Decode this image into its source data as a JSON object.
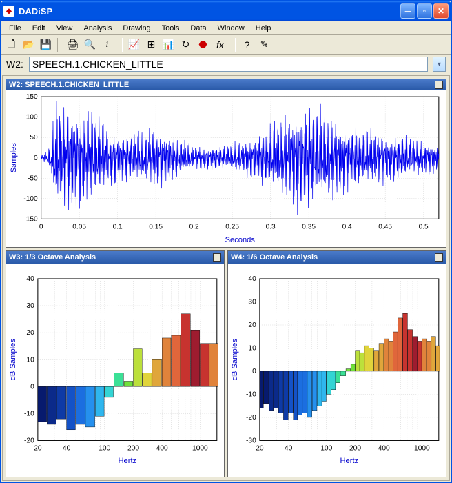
{
  "title": "DADiSP",
  "menus": [
    "File",
    "Edit",
    "View",
    "Analysis",
    "Drawing",
    "Tools",
    "Data",
    "Window",
    "Help"
  ],
  "formula": {
    "label": "W2:",
    "value": "SPEECH.1.CHICKEN_LITTLE"
  },
  "panels": {
    "top": {
      "title": "W2: SPEECH.1.CHICKEN_LITTLE",
      "xlabel": "Seconds",
      "ylabel": "Samples"
    },
    "left": {
      "title": "W3: 1/3 Octave Analysis",
      "xlabel": "Hertz",
      "ylabel": "dB Samples"
    },
    "right": {
      "title": "W4: 1/6 Octave Analysis",
      "xlabel": "Hertz",
      "ylabel": "dB Samples"
    }
  },
  "chart_data": [
    {
      "id": "W2",
      "type": "line",
      "xlabel": "Seconds",
      "ylabel": "Samples",
      "xlim": [
        0,
        0.52
      ],
      "ylim": [
        -150,
        150
      ],
      "xticks": [
        0,
        0.05,
        0.1,
        0.15,
        0.2,
        0.25,
        0.3,
        0.35,
        0.4,
        0.45,
        0.5
      ],
      "yticks": [
        -150,
        -100,
        -50,
        0,
        50,
        100,
        150
      ],
      "note": "Speech waveform; dense oscillating amplitude time-series (~4000 samples). Envelope peaks ~±120 near 0.02–0.07s and 0.32–0.38s, quieter region ±30 around 0.2–0.28s."
    },
    {
      "id": "W3",
      "type": "bar",
      "title": "1/3 Octave Analysis",
      "xlabel": "Hertz",
      "ylabel": "dB Samples",
      "xscale": "log",
      "xlim": [
        20,
        1500
      ],
      "ylim": [
        -20,
        40
      ],
      "xticks": [
        20,
        40,
        100,
        200,
        400,
        1000
      ],
      "yticks": [
        -20,
        -10,
        0,
        10,
        20,
        30,
        40
      ],
      "categories": [
        20,
        25,
        31.5,
        40,
        50,
        63,
        80,
        100,
        125,
        160,
        200,
        250,
        315,
        400,
        500,
        630,
        800,
        1000,
        1250
      ],
      "values": [
        -13,
        -14,
        -12,
        -16,
        -14,
        -15,
        -11,
        -4,
        5,
        2,
        14,
        5,
        10,
        18,
        19,
        27,
        21,
        16,
        16,
        17
      ],
      "colors": [
        "#071a6e",
        "#0b2a8a",
        "#0e3aa6",
        "#1452c7",
        "#1b6ee0",
        "#2590ee",
        "#2fb6ee",
        "#33d4d4",
        "#3be096",
        "#6fe03b",
        "#bce03b",
        "#e0d43b",
        "#e0a63b",
        "#e0833b",
        "#e0663b",
        "#c7332f",
        "#9e1c2f",
        "#c7332f",
        "#e0833b",
        "#e0a63b"
      ]
    },
    {
      "id": "W4",
      "type": "bar",
      "title": "1/6 Octave Analysis",
      "xlabel": "Hertz",
      "ylabel": "dB Samples",
      "xscale": "log",
      "xlim": [
        20,
        1500
      ],
      "ylim": [
        -30,
        40
      ],
      "xticks": [
        20,
        40,
        100,
        200,
        400,
        1000
      ],
      "yticks": [
        -30,
        -20,
        -10,
        0,
        10,
        20,
        30,
        40
      ],
      "categories": [
        20,
        22,
        25,
        28,
        31.5,
        35.5,
        40,
        45,
        50,
        56,
        63,
        71,
        80,
        90,
        100,
        112,
        125,
        140,
        160,
        180,
        200,
        224,
        250,
        280,
        315,
        355,
        400,
        450,
        500,
        560,
        630,
        710,
        800,
        900,
        1000,
        1120,
        1250,
        1400
      ],
      "values": [
        -16,
        -14,
        -17,
        -16,
        -18,
        -21,
        -18,
        -21,
        -19,
        -18,
        -20,
        -17,
        -15,
        -13,
        -10,
        -8,
        -5,
        -2,
        1,
        3,
        9,
        8,
        11,
        10,
        9,
        12,
        14,
        13,
        17,
        23,
        25,
        18,
        15,
        13,
        14,
        13,
        15,
        11
      ],
      "colors": [
        "#071a6e",
        "#071a6e",
        "#0b2a8a",
        "#0b2a8a",
        "#0e3aa6",
        "#0e3aa6",
        "#1452c7",
        "#1452c7",
        "#1b6ee0",
        "#1b6ee0",
        "#2590ee",
        "#2590ee",
        "#2fb6ee",
        "#2fb6ee",
        "#33d4d4",
        "#33d4d4",
        "#3be096",
        "#3be096",
        "#6fe03b",
        "#6fe03b",
        "#bce03b",
        "#bce03b",
        "#e0d43b",
        "#e0d43b",
        "#e0a63b",
        "#e0a63b",
        "#e0833b",
        "#e0833b",
        "#e0663b",
        "#e0663b",
        "#c7332f",
        "#c7332f",
        "#9e1c2f",
        "#c7332f",
        "#e0833b",
        "#e0833b",
        "#e0a63b",
        "#e0a63b"
      ]
    }
  ]
}
